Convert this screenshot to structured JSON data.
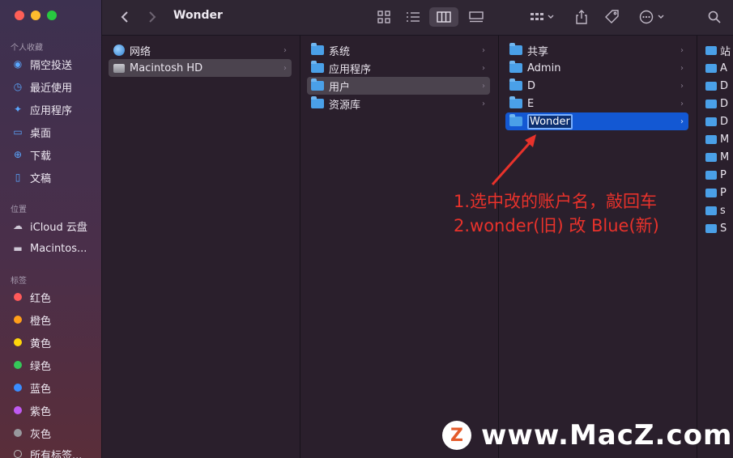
{
  "window": {
    "title": "Wonder"
  },
  "sidebar": {
    "favorites_label": "个人收藏",
    "favorites": [
      {
        "icon": "airdrop-icon",
        "label": "隔空投送"
      },
      {
        "icon": "clock-icon",
        "label": "最近使用"
      },
      {
        "icon": "applications-icon",
        "label": "应用程序"
      },
      {
        "icon": "desktop-icon",
        "label": "桌面"
      },
      {
        "icon": "downloads-icon",
        "label": "下载"
      },
      {
        "icon": "document-icon",
        "label": "文稿"
      }
    ],
    "locations_label": "位置",
    "locations": [
      {
        "icon": "icloud-icon",
        "label": "iCloud 云盘"
      },
      {
        "icon": "harddisk-icon",
        "label": "Macintos..."
      }
    ],
    "tags_label": "标签",
    "tags": [
      {
        "label": "红色",
        "color": "#ff5a5a"
      },
      {
        "label": "橙色",
        "color": "#ff9f1a"
      },
      {
        "label": "黄色",
        "color": "#ffd60a"
      },
      {
        "label": "绿色",
        "color": "#35c759"
      },
      {
        "label": "蓝色",
        "color": "#3a8dff"
      },
      {
        "label": "紫色",
        "color": "#bf5af2"
      },
      {
        "label": "灰色",
        "color": "#98989d"
      },
      {
        "label": "所有标签..."
      }
    ]
  },
  "column1": [
    {
      "label": "网络"
    },
    {
      "label": "Macintosh HD"
    }
  ],
  "column2": [
    {
      "label": "系统"
    },
    {
      "label": "应用程序"
    },
    {
      "label": "用户"
    },
    {
      "label": "资源库"
    }
  ],
  "column3": [
    {
      "label": "共享"
    },
    {
      "label": "Admin"
    },
    {
      "label": "D"
    },
    {
      "label": "E"
    },
    {
      "label": "Wonder"
    }
  ],
  "column4": [
    "站",
    "A",
    "D",
    "D",
    "D",
    "M",
    "M",
    "P",
    "P",
    "s",
    "S"
  ],
  "annotation": {
    "line1": "1.选中改的账户名，敲回车",
    "line2": "2.wonder(旧) 改 Blue(新)"
  },
  "watermark": {
    "badge": "Z",
    "text": "www.MacZ.com"
  }
}
